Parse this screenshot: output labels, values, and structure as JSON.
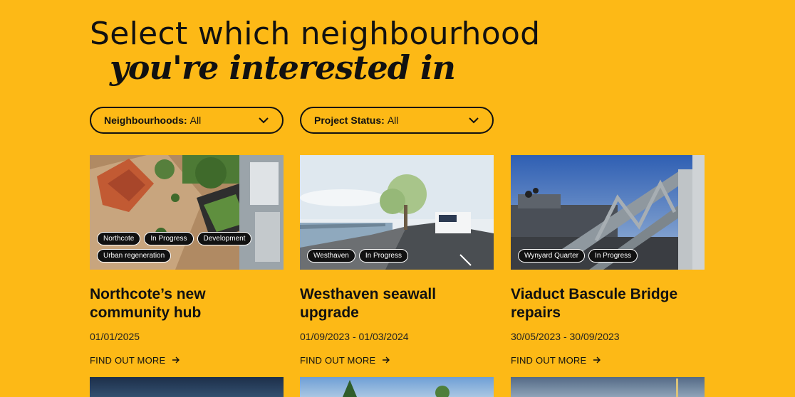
{
  "heading": {
    "line1": "Select which neighbourhood",
    "line2": "you're interested in"
  },
  "filters": [
    {
      "label": "Neighbourhoods:",
      "value": "All",
      "icon": "chevron-down-icon"
    },
    {
      "label": "Project Status:",
      "value": "All",
      "icon": "chevron-down-icon"
    }
  ],
  "cards": [
    {
      "tags": [
        "Northcote",
        "In Progress",
        "Development",
        "Urban regeneration"
      ],
      "title": "Northcote’s new community hub",
      "date": "01/01/2025",
      "link": "FIND OUT MORE"
    },
    {
      "tags": [
        "Westhaven",
        "In Progress"
      ],
      "title": "Westhaven seawall upgrade",
      "date": "01/09/2023 - 01/03/2024",
      "link": "FIND OUT MORE"
    },
    {
      "tags": [
        "Wynyard Quarter",
        "In Progress"
      ],
      "title": "Viaduct Bascule Bridge repairs",
      "date": "30/05/2023 - 30/09/2023",
      "link": "FIND OUT MORE"
    }
  ],
  "colors": {
    "background": "#FDB916",
    "text": "#111111",
    "tag_bg": "#111111"
  }
}
